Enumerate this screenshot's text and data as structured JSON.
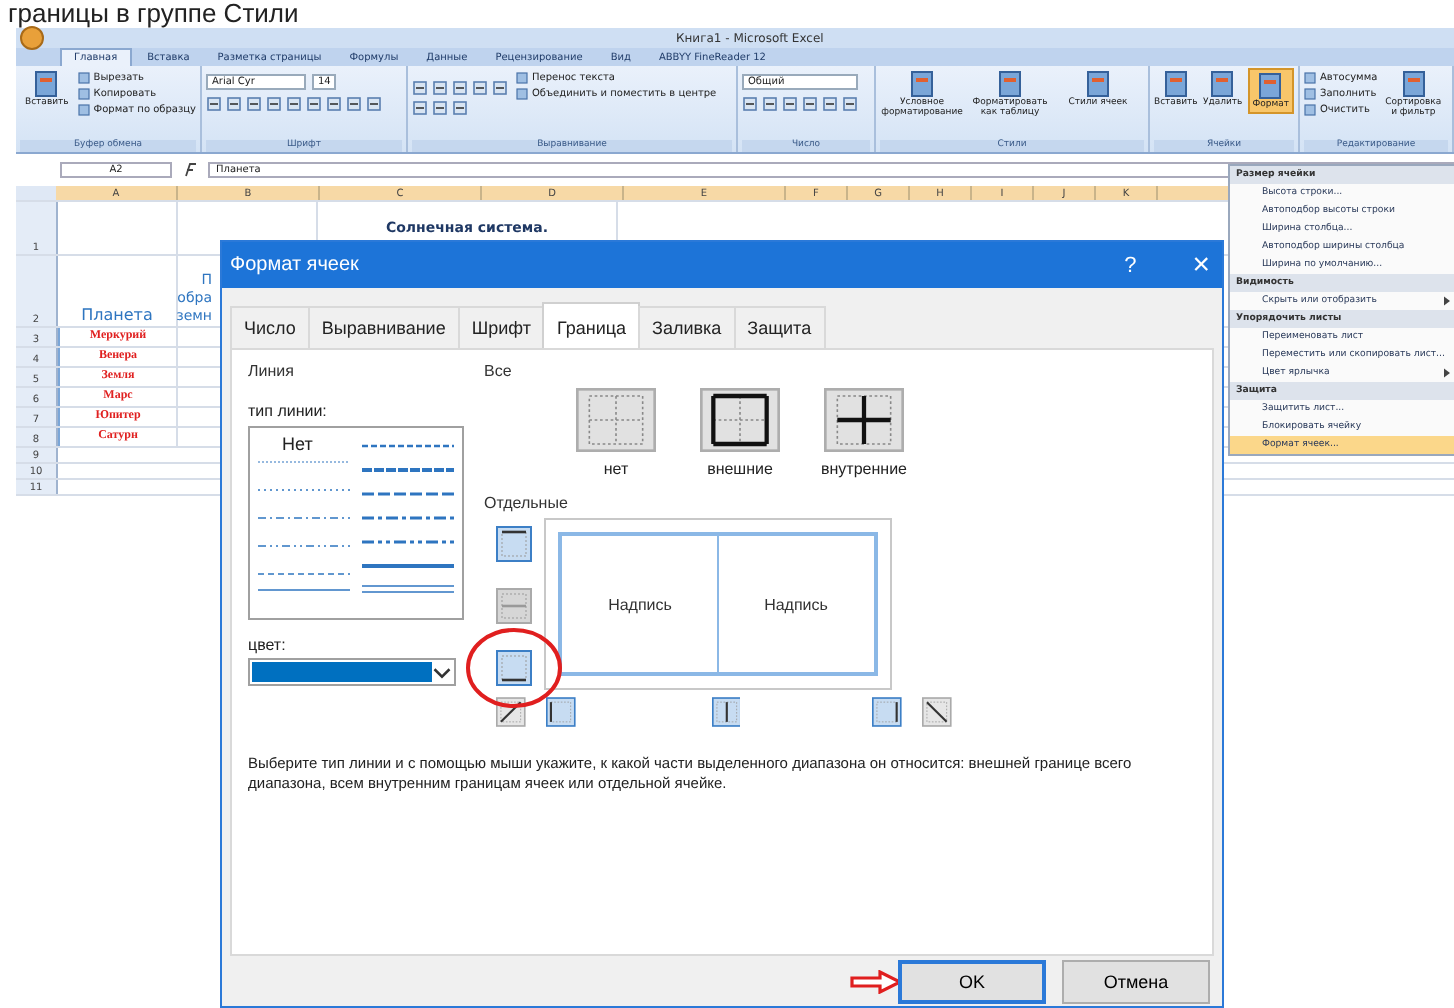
{
  "caption": "границы в группе Стили",
  "excel": {
    "title": "Книга1 - Microsoft Excel",
    "tabs": [
      {
        "label": "Главная",
        "selected": true
      },
      {
        "label": "Вставка",
        "selected": false
      },
      {
        "label": "Разметка страницы",
        "selected": false
      },
      {
        "label": "Формулы",
        "selected": false
      },
      {
        "label": "Данные",
        "selected": false
      },
      {
        "label": "Рецензирование",
        "selected": false
      },
      {
        "label": "Вид",
        "selected": false
      },
      {
        "label": "ABBYY FineReader 12",
        "selected": false
      }
    ],
    "ribbon": [
      {
        "name": "Буфер обмена",
        "kind": "clipboard",
        "large": [
          {
            "label": "Вставить",
            "selected": false
          }
        ],
        "small": [
          "Вырезать",
          "Копировать",
          "Формат по образцу"
        ]
      },
      {
        "name": "Шрифт",
        "kind": "font",
        "fields": [
          "Arial Cyr",
          "14"
        ]
      },
      {
        "name": "Выравнивание",
        "kind": "alignment",
        "small": [
          "Перенос текста",
          "Объединить и поместить в центре"
        ]
      },
      {
        "name": "Число",
        "kind": "number",
        "fields": [
          "Общий"
        ]
      },
      {
        "name": "Стили",
        "kind": "styles",
        "large": [
          {
            "label": "Условное форматирование",
            "selected": false
          },
          {
            "label": "Форматировать как таблицу",
            "selected": false
          },
          {
            "label": "Стили ячеек",
            "selected": false
          }
        ]
      },
      {
        "name": "Ячейки",
        "kind": "cells",
        "large": [
          {
            "label": "Вставить",
            "selected": false
          },
          {
            "label": "Удалить",
            "selected": false
          },
          {
            "label": "Формат",
            "selected": true
          }
        ]
      },
      {
        "name": "Редактирование",
        "kind": "editing",
        "small": [
          "Автосумма",
          "Заполнить",
          "Очистить"
        ],
        "large": [
          {
            "label": "Сортировка и фильтр",
            "selected": false
          }
        ]
      }
    ],
    "name_box": "A2",
    "formula": "Планета",
    "columns": [
      "A",
      "B",
      "C",
      "D",
      "E",
      "F",
      "G",
      "H",
      "I",
      "J",
      "K"
    ],
    "rows": [
      {
        "number": "1",
        "kind": "title",
        "cells": [
          {
            "text": ""
          },
          {
            "text": ""
          },
          {
            "text": "Солнечная система."
          }
        ]
      },
      {
        "number": "2",
        "kind": "header",
        "cells": [
          {
            "text": "Планета"
          },
          {
            "lines": [
              "П",
              "обра",
              "земн"
            ]
          }
        ]
      },
      {
        "number": "3",
        "kind": "planet",
        "cells": [
          {
            "text": "Меркурий"
          }
        ]
      },
      {
        "number": "4",
        "kind": "planet",
        "cells": [
          {
            "text": "Венера"
          }
        ]
      },
      {
        "number": "5",
        "kind": "planet",
        "cells": [
          {
            "text": "Земля"
          }
        ]
      },
      {
        "number": "6",
        "kind": "planet",
        "cells": [
          {
            "text": "Марс"
          }
        ]
      },
      {
        "number": "7",
        "kind": "planet",
        "cells": [
          {
            "text": "Юпитер"
          }
        ]
      },
      {
        "number": "8",
        "kind": "planet",
        "cells": [
          {
            "text": "Сатурн"
          }
        ]
      },
      {
        "number": "9",
        "kind": "empty",
        "cells": []
      },
      {
        "number": "10",
        "kind": "empty",
        "cells": []
      },
      {
        "number": "11",
        "kind": "empty",
        "cells": []
      }
    ]
  },
  "format_menu": [
    {
      "header": "Размер ячейки",
      "items": [
        {
          "label": "Высота строки...",
          "highlighted": false,
          "submenu": false
        },
        {
          "label": "Автоподбор высоты строки",
          "highlighted": false,
          "submenu": false
        },
        {
          "label": "Ширина столбца...",
          "highlighted": false,
          "submenu": false
        },
        {
          "label": "Автоподбор ширины столбца",
          "highlighted": false,
          "submenu": false
        },
        {
          "label": "Ширина по умолчанию...",
          "highlighted": false,
          "submenu": false
        }
      ]
    },
    {
      "header": "Видимость",
      "items": [
        {
          "label": "Скрыть или отобразить",
          "highlighted": false,
          "submenu": true
        }
      ]
    },
    {
      "header": "Упорядочить листы",
      "items": [
        {
          "label": "Переименовать лист",
          "highlighted": false,
          "submenu": false
        },
        {
          "label": "Переместить или скопировать лист...",
          "highlighted": false,
          "submenu": false
        },
        {
          "label": "Цвет ярлычка",
          "highlighted": false,
          "submenu": true
        }
      ]
    },
    {
      "header": "Защита",
      "items": [
        {
          "label": "Защитить лист...",
          "highlighted": false,
          "submenu": false
        },
        {
          "label": "Блокировать ячейку",
          "highlighted": false,
          "submenu": false
        },
        {
          "label": "Формат ячеек...",
          "highlighted": true,
          "submenu": false
        }
      ]
    }
  ],
  "dialog": {
    "title": "Формат ячеек",
    "help": "?",
    "close": "×",
    "tabs": [
      {
        "label": "Число",
        "selected": false
      },
      {
        "label": "Выравнивание",
        "selected": false
      },
      {
        "label": "Шрифт",
        "selected": false
      },
      {
        "label": "Граница",
        "selected": true
      },
      {
        "label": "Заливка",
        "selected": false
      },
      {
        "label": "Защита",
        "selected": false
      }
    ],
    "line_group": "Линия",
    "line_type_label": "тип линии:",
    "line_none": "Нет",
    "color_label": "цвет:",
    "all_group": "Все",
    "presets": [
      {
        "kind": "none",
        "label": "нет"
      },
      {
        "kind": "outer",
        "label": "внешние"
      },
      {
        "kind": "inner",
        "label": "внутренние"
      }
    ],
    "separate_group": "Отдельные",
    "side_buttons": [
      {
        "kind": "top",
        "selected": true,
        "disabled": false,
        "circled": false
      },
      {
        "kind": "middle_h",
        "selected": false,
        "disabled": true,
        "circled": false
      },
      {
        "kind": "bottom",
        "selected": true,
        "disabled": false,
        "circled": true
      }
    ],
    "bottom_buttons": [
      {
        "kind": "diag_up",
        "selected": false,
        "disabled": false
      },
      {
        "kind": "left",
        "selected": true,
        "disabled": false
      },
      {
        "kind": "middle_v",
        "selected": true,
        "disabled": false
      },
      {
        "kind": "right",
        "selected": true,
        "disabled": false
      },
      {
        "kind": "diag_down",
        "selected": false,
        "disabled": false
      }
    ],
    "preview_labels": [
      "Надпись",
      "Надпись"
    ],
    "hint": "Выберите тип линии и с помощью мыши укажите, к какой части выделенного диапазона он относится: внешней границе всего диапазона, всем внутренним границам ячеек или отдельной ячейке.",
    "buttons": [
      {
        "label": "OK",
        "default": true,
        "arrow": true
      },
      {
        "label": "Отмена",
        "default": false,
        "arrow": false
      }
    ]
  }
}
